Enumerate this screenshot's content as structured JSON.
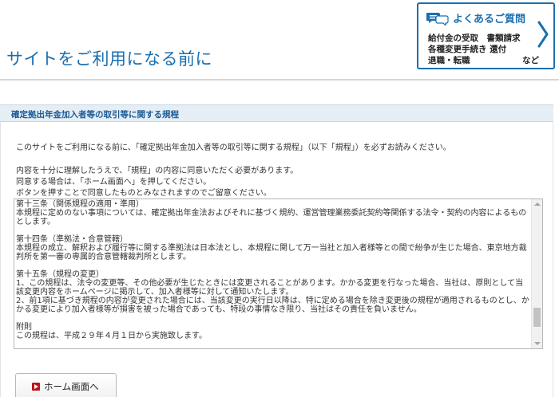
{
  "header": {
    "title": "サイトをご利用になる前に"
  },
  "faq": {
    "icon": "chat-bubbles-icon",
    "title": "よくあるご質問",
    "line1": "給付金の受取　書類請求",
    "line2": "各種変更手続き 還付",
    "line3": "退職・転職",
    "line3_etc": "など",
    "chevron": "chevron-right-icon",
    "accent_color": "#1a6fb0"
  },
  "section": {
    "title": "確定拠出年金加入者等の取引等に関する規程"
  },
  "intro": {
    "p1": "このサイトをご利用になる前に、「確定拠出年金加入者等の取引等に関する規程」（以下「規程」）を必ずお読みください。",
    "p2": "内容を十分に理解したうえで、「規程」の内容に同意いただく必要があります。",
    "p3": "同意する場合は、「ホーム画面へ」を押してください。",
    "p4": "ボタンを押すことで同意したものとみなされますのでご留意ください。"
  },
  "rules": {
    "text": "第十三条（関係規程の適用・準用）\n本規程に定めのない事項については、確定拠出年金法およびそれに基づく規約、運営管理業務委託契約等関係する法令・契約の内容によるものとします。\n\n第十四条（準拠法・合意管轄）\n本規程の成立、解釈および履行等に関する準拠法は日本法とし、本規程に関して万一当社と加入者様等との間で紛争が生じた場合、東京地方裁判所を第一審の専属的合意管轄裁判所とします。\n\n第十五条（規程の変更）\n1、この規程は、法令の変更等、その他必要が生じたときには変更されることがあります。かかる変更を行なった場合、当社は、原則として当該変更内容をホームページに掲示して、加入者様等に対して通知いたします。\n2、前1項に基づき規程の内容が変更された場合には、当該変更の実行日以降は、特に定める場合を除き変更後の規程が適用されるものとし、かかる変更により加入者様等が損害を被った場合であっても、特段の事情なき限り、当社はその責任を負いません。\n\n附則\nこの規程は、平成２９年４月１日から実施致します。"
  },
  "button": {
    "home_label": "ホーム画面へ",
    "icon": "play-icon",
    "icon_color": "#c0121a"
  }
}
